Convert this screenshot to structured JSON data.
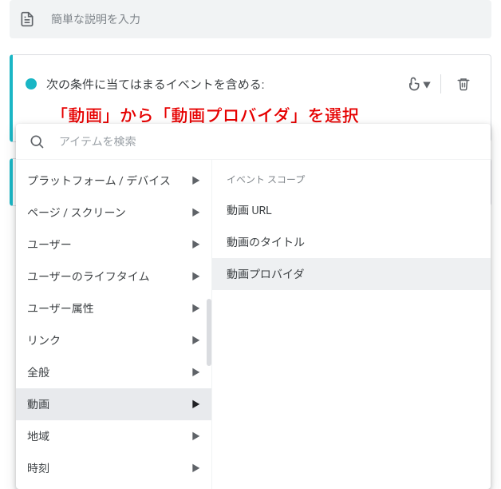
{
  "description": {
    "placeholder": "簡単な説明を入力"
  },
  "condition_card": {
    "title": "次の条件に当てはまるイベントを含める:"
  },
  "annotation": "「動画」から「動画プロバイダ」を選択",
  "popup": {
    "search_placeholder": "アイテムを検索",
    "categories": [
      {
        "label": "プラットフォーム / デバイス",
        "selected": false
      },
      {
        "label": "ページ / スクリーン",
        "selected": false
      },
      {
        "label": "ユーザー",
        "selected": false
      },
      {
        "label": "ユーザーのライフタイム",
        "selected": false
      },
      {
        "label": "ユーザー属性",
        "selected": false
      },
      {
        "label": "リンク",
        "selected": false
      },
      {
        "label": "全般",
        "selected": false
      },
      {
        "label": "動画",
        "selected": true
      },
      {
        "label": "地域",
        "selected": false
      },
      {
        "label": "時刻",
        "selected": false
      }
    ],
    "scope_label": "イベント スコープ",
    "items": [
      {
        "label": "動画 URL",
        "selected": false
      },
      {
        "label": "動画のタイトル",
        "selected": false
      },
      {
        "label": "動画プロバイダ",
        "selected": true
      }
    ]
  }
}
